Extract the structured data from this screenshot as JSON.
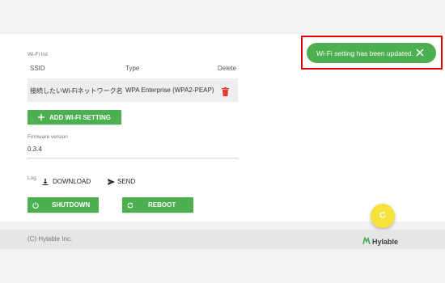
{
  "wifi": {
    "section_label": "Wi-Fi list",
    "columns": {
      "ssid": "SSID",
      "type": "Type",
      "delete": "Delete"
    },
    "rows": [
      {
        "ssid": "接続したいWi-Fiネットワーク名",
        "type": "WPA Enterprise (WPA2-PEAP)"
      }
    ],
    "add_button_label": "ADD WI-FI SETTING"
  },
  "firmware": {
    "label": "Firmware version",
    "value": "0.3.4"
  },
  "log": {
    "label": "Log",
    "download_label": "DOWNLOAD",
    "send_label": "SEND"
  },
  "power": {
    "shutdown_label": "SHUTDOWN",
    "reboot_label": "REBOOT"
  },
  "toast": {
    "message": "Wi-Fi setting has been updated."
  },
  "footer": {
    "copyright": "(C) Hylable Inc.",
    "logo_text": "Hylable"
  },
  "colors": {
    "primary_green": "#4caf50",
    "delete_red": "#e53935",
    "fab_yellow": "#f7e13b",
    "highlight_red": "#e00000"
  },
  "icons": [
    "plus-icon",
    "trash-icon",
    "download-icon",
    "send-icon",
    "power-icon",
    "sync-icon",
    "close-icon",
    "refresh-icon",
    "hylable-logo-icon"
  ]
}
